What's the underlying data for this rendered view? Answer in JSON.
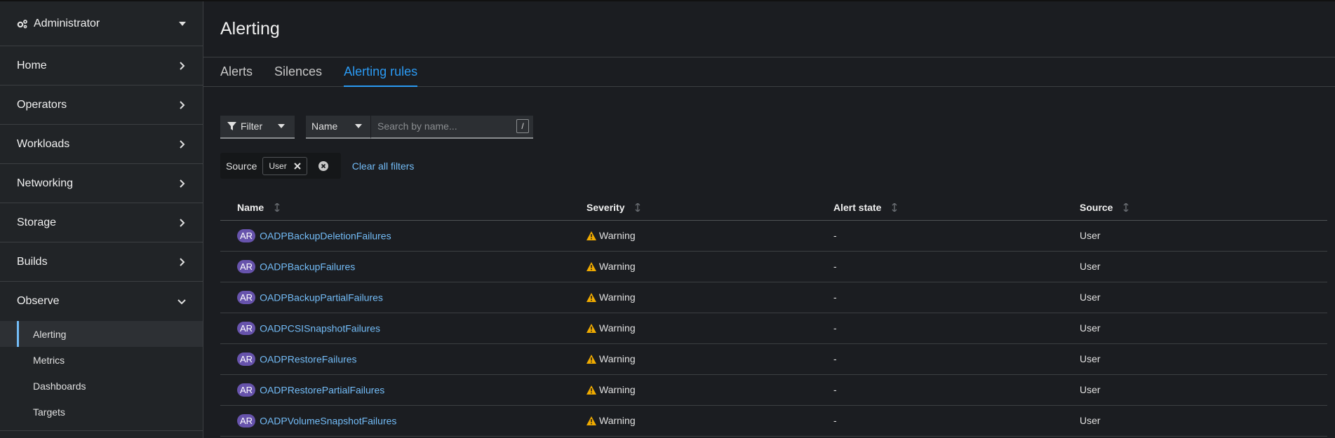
{
  "perspective": {
    "label": "Administrator",
    "icon": "gears-icon"
  },
  "nav": {
    "items": [
      {
        "label": "Home"
      },
      {
        "label": "Operators"
      },
      {
        "label": "Workloads"
      },
      {
        "label": "Networking"
      },
      {
        "label": "Storage"
      },
      {
        "label": "Builds"
      }
    ],
    "observe": {
      "label": "Observe",
      "subitems": [
        "Alerting",
        "Metrics",
        "Dashboards",
        "Targets"
      ],
      "active": "Alerting"
    }
  },
  "page": {
    "title": "Alerting",
    "tabs": [
      "Alerts",
      "Silences",
      "Alerting rules"
    ],
    "active_tab": "Alerting rules"
  },
  "toolbar": {
    "filter_label": "Filter",
    "name_select": "Name",
    "search_placeholder": "Search by name...",
    "search_shortcut": "/"
  },
  "chips": {
    "category": "Source",
    "value": "User",
    "clear_label": "Clear all filters"
  },
  "table": {
    "headers": [
      "Name",
      "Severity",
      "Alert state",
      "Source"
    ],
    "rows": [
      {
        "badge": "AR",
        "name": "OADPBackupDeletionFailures",
        "severity": "Warning",
        "state": "-",
        "source": "User"
      },
      {
        "badge": "AR",
        "name": "OADPBackupFailures",
        "severity": "Warning",
        "state": "-",
        "source": "User"
      },
      {
        "badge": "AR",
        "name": "OADPBackupPartialFailures",
        "severity": "Warning",
        "state": "-",
        "source": "User"
      },
      {
        "badge": "AR",
        "name": "OADPCSISnapshotFailures",
        "severity": "Warning",
        "state": "-",
        "source": "User"
      },
      {
        "badge": "AR",
        "name": "OADPRestoreFailures",
        "severity": "Warning",
        "state": "-",
        "source": "User"
      },
      {
        "badge": "AR",
        "name": "OADPRestorePartialFailures",
        "severity": "Warning",
        "state": "-",
        "source": "User"
      },
      {
        "badge": "AR",
        "name": "OADPVolumeSnapshotFailures",
        "severity": "Warning",
        "state": "-",
        "source": "User"
      }
    ]
  },
  "colors": {
    "accent": "#2b9af3",
    "link": "#73bcf7",
    "warning": "#f0ab00",
    "badge": "#6753ac"
  }
}
